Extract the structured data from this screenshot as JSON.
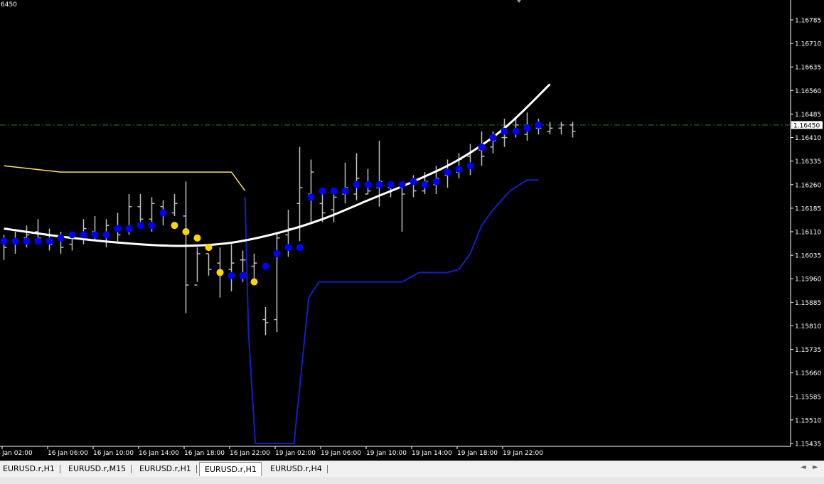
{
  "window": {
    "corner_label": "6450"
  },
  "chart_data": {
    "type": "ohlc",
    "symbol": "EURUSD.r",
    "timeframe": "H1",
    "ylim": [
      1.15435,
      1.16848
    ],
    "y_ticks": [
      "1.16785",
      "1.16710",
      "1.16635",
      "1.16560",
      "1.16485",
      "1.16410",
      "1.16335",
      "1.16260",
      "1.16185",
      "1.16110",
      "1.16035",
      "1.15960",
      "1.15885",
      "1.15810",
      "1.15735",
      "1.15660",
      "1.15585",
      "1.15510",
      "1.15435"
    ],
    "x_ticks": [
      "Jan 02:00",
      "16 Jan 06:00",
      "16 Jan 10:00",
      "16 Jan 14:00",
      "16 Jan 18:00",
      "16 Jan 22:00",
      "19 Jan 02:00",
      "19 Jan 06:00",
      "19 Jan 10:00",
      "19 Jan 14:00",
      "19 Jan 18:00",
      "19 Jan 22:00"
    ],
    "current_price": "1.16450",
    "bars": [
      [
        1.1608,
        1.161,
        1.1602,
        1.1606
      ],
      [
        1.1608,
        1.1611,
        1.1604,
        1.1608
      ],
      [
        1.1609,
        1.1613,
        1.1606,
        1.161
      ],
      [
        1.1611,
        1.1615,
        1.1607,
        1.1609
      ],
      [
        1.1608,
        1.1612,
        1.1605,
        1.1607
      ],
      [
        1.1609,
        1.1611,
        1.1604,
        1.1606
      ],
      [
        1.1607,
        1.1611,
        1.1605,
        1.161
      ],
      [
        1.161,
        1.1615,
        1.1607,
        1.1612
      ],
      [
        1.1611,
        1.1616,
        1.1608,
        1.161
      ],
      [
        1.161,
        1.1615,
        1.1606,
        1.1613
      ],
      [
        1.1612,
        1.1617,
        1.1608,
        1.161
      ],
      [
        1.1612,
        1.1623,
        1.161,
        1.1619
      ],
      [
        1.1619,
        1.1623,
        1.1612,
        1.1615
      ],
      [
        1.1615,
        1.1622,
        1.1611,
        1.162
      ],
      [
        1.1619,
        1.1621,
        1.1613,
        1.1617
      ],
      [
        1.1617,
        1.1623,
        1.1616,
        1.162
      ],
      [
        1.1616,
        1.1627,
        1.1585,
        1.1594
      ],
      [
        1.1594,
        1.1606,
        1.1595,
        1.1604
      ],
      [
        1.1604,
        1.1604,
        1.1597,
        1.1599
      ],
      [
        1.1601,
        1.1606,
        1.159,
        1.1598
      ],
      [
        1.1599,
        1.1607,
        1.1592,
        1.1601
      ],
      [
        1.1602,
        1.1605,
        1.1595,
        1.1602
      ],
      [
        1.16,
        1.1604,
        1.1596,
        1.1601
      ],
      [
        1.1583,
        1.1587,
        1.1578,
        1.1582
      ],
      [
        1.1583,
        1.1611,
        1.1579,
        1.1609
      ],
      [
        1.161,
        1.1618,
        1.1603,
        1.1612
      ],
      [
        1.162,
        1.1638,
        1.1608,
        1.1625
      ],
      [
        1.1623,
        1.1634,
        1.1614,
        1.163
      ],
      [
        1.162,
        1.1624,
        1.1614,
        1.1617
      ],
      [
        1.1618,
        1.1625,
        1.1614,
        1.1622
      ],
      [
        1.1623,
        1.1633,
        1.162,
        1.1625
      ],
      [
        1.1623,
        1.1636,
        1.1621,
        1.1628
      ],
      [
        1.1623,
        1.1631,
        1.1623,
        1.1624
      ],
      [
        1.1625,
        1.164,
        1.1619,
        1.1627
      ],
      [
        1.1625,
        1.1627,
        1.1622,
        1.1626
      ],
      [
        1.1625,
        1.1627,
        1.1611,
        1.1623
      ],
      [
        1.1627,
        1.1629,
        1.1622,
        1.1624
      ],
      [
        1.1624,
        1.163,
        1.1623,
        1.1627
      ],
      [
        1.1626,
        1.1632,
        1.1623,
        1.1628
      ],
      [
        1.1629,
        1.1634,
        1.1625,
        1.163
      ],
      [
        1.163,
        1.1636,
        1.1628,
        1.1634
      ],
      [
        1.1635,
        1.1639,
        1.1629,
        1.1632
      ],
      [
        1.1637,
        1.1643,
        1.1632,
        1.1635
      ],
      [
        1.1638,
        1.1643,
        1.1636,
        1.164
      ],
      [
        1.1641,
        1.1647,
        1.1638,
        1.1641
      ],
      [
        1.1643,
        1.1647,
        1.1641,
        1.1645
      ],
      [
        1.1642,
        1.1649,
        1.164,
        1.1644
      ],
      [
        1.1644,
        1.1647,
        1.1642,
        1.1644
      ],
      [
        1.1643,
        1.1646,
        1.1642,
        1.1644
      ],
      [
        1.1644,
        1.1646,
        1.1642,
        1.1645
      ],
      [
        1.1645,
        1.1646,
        1.1641,
        1.1643
      ]
    ],
    "dots": [
      [
        1.1608,
        "blue"
      ],
      [
        1.1608,
        "blue"
      ],
      [
        1.1608,
        "blue"
      ],
      [
        1.1608,
        "blue"
      ],
      [
        1.1608,
        "blue"
      ],
      [
        1.1609,
        "blue"
      ],
      [
        1.161,
        "blue"
      ],
      [
        1.161,
        "blue"
      ],
      [
        1.161,
        "blue"
      ],
      [
        1.161,
        "blue"
      ],
      [
        1.1612,
        "blue"
      ],
      [
        1.1612,
        "blue"
      ],
      [
        1.1613,
        "blue"
      ],
      [
        1.1613,
        "blue"
      ],
      [
        1.1617,
        "blue"
      ],
      [
        1.1613,
        "yellow"
      ],
      [
        1.1611,
        "yellow"
      ],
      [
        1.1609,
        "yellow"
      ],
      [
        1.1606,
        "yellow"
      ],
      [
        1.1598,
        "yellow"
      ],
      [
        1.1597,
        "blue"
      ],
      [
        1.1597,
        "blue"
      ],
      [
        1.1595,
        "yellow"
      ],
      [
        1.16,
        "blue"
      ],
      [
        1.1604,
        "blue"
      ],
      [
        1.1606,
        "blue"
      ],
      [
        1.1606,
        "blue"
      ],
      [
        1.1622,
        "blue"
      ],
      [
        1.1624,
        "blue"
      ],
      [
        1.1624,
        "blue"
      ],
      [
        1.1624,
        "blue"
      ],
      [
        1.1626,
        "blue"
      ],
      [
        1.1626,
        "blue"
      ],
      [
        1.1626,
        "blue"
      ],
      [
        1.1626,
        "blue"
      ],
      [
        1.1626,
        "blue"
      ],
      [
        1.1627,
        "blue"
      ],
      [
        1.1626,
        "blue"
      ],
      [
        1.1627,
        "blue"
      ],
      [
        1.163,
        "blue"
      ],
      [
        1.1631,
        "blue"
      ],
      [
        1.1632,
        "blue"
      ],
      [
        1.1638,
        "blue"
      ],
      [
        1.1641,
        "blue"
      ],
      [
        1.1643,
        "blue"
      ],
      [
        1.1643,
        "blue"
      ],
      [
        1.1644,
        "blue"
      ],
      [
        1.1645,
        "blue"
      ]
    ],
    "white_curve": [
      [
        0,
        1.1612
      ],
      [
        6,
        1.1609
      ],
      [
        12,
        1.1607
      ],
      [
        16,
        1.16065
      ],
      [
        20,
        1.16075
      ],
      [
        24,
        1.16105
      ],
      [
        28,
        1.1615
      ],
      [
        32,
        1.1621
      ],
      [
        36,
        1.1627
      ],
      [
        40,
        1.1634
      ],
      [
        44,
        1.1644
      ],
      [
        48,
        1.1658
      ]
    ],
    "yellow_line": [
      [
        0,
        1.1632
      ],
      [
        5,
        1.163
      ],
      [
        20,
        1.163
      ],
      [
        21.2,
        1.1624
      ]
    ],
    "blue_line": [
      [
        21.2,
        1.1622
      ],
      [
        21.5,
        1.1579
      ],
      [
        22.1,
        1.15435
      ],
      [
        25.5,
        1.15435
      ],
      [
        26.8,
        1.159
      ],
      [
        27.7,
        1.1595
      ],
      [
        35,
        1.1595
      ],
      [
        36.5,
        1.1598
      ],
      [
        39,
        1.1598
      ],
      [
        40,
        1.1599
      ],
      [
        41,
        1.1604
      ],
      [
        42,
        1.1613
      ],
      [
        43,
        1.1618
      ],
      [
        44.5,
        1.1624
      ],
      [
        46,
        1.16275
      ],
      [
        47,
        1.16275
      ]
    ],
    "colors": {
      "bars": "#c0c0c0",
      "blue_dot": "#0000ff",
      "yellow_dot": "#ffd700",
      "curve": "#ffffff",
      "upper_line": "#ffe066",
      "lower_line": "#1020c8",
      "price_line": "#2e7d32",
      "axis": "#ffffff"
    }
  },
  "tabs": [
    {
      "label": "EURUSD.r,H1",
      "active": false
    },
    {
      "label": "EURUSD.r,M15",
      "active": false
    },
    {
      "label": "EURUSD.r,H1",
      "active": false
    },
    {
      "label": "EURUSD.r,H1",
      "active": true
    },
    {
      "label": "EURUSD.r,H4",
      "active": false
    }
  ],
  "nav": {
    "left": "◄",
    "right": "►"
  }
}
